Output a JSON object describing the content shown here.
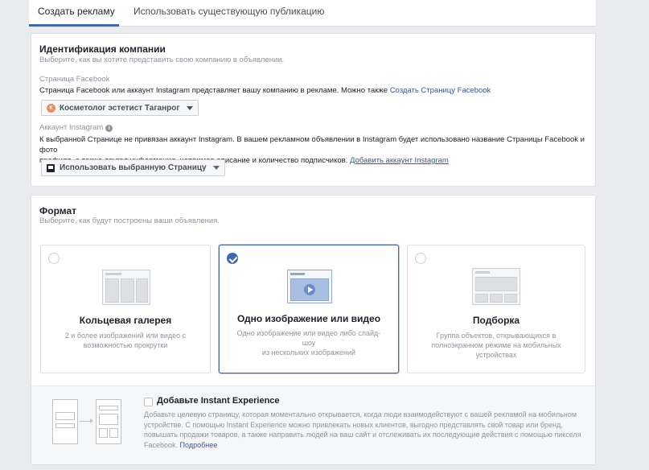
{
  "tabs": [
    {
      "label": "Создать рекламу",
      "active": true
    },
    {
      "label": "Использовать существующую публикацию",
      "active": false
    }
  ],
  "identity": {
    "title": "Идентификация компании",
    "subtitle": "Выберите, как вы хотите представить свою компанию в объявлении.",
    "fb_label": "Страница Facebook",
    "fb_text": "Страница Facebook или аккаунт Instagram представляет вашу компанию в рекламе. Можно также",
    "fb_link": "Создать Страницу Facebook",
    "page_dropdown": "Косметолог эстетист Таганрог",
    "page_avatar_letter": "К",
    "ig_label": "Аккаунт Instagram",
    "ig_text_1": "К выбранной Странице не привязан аккаунт Instagram. В вашем рекламном объявлении в Instagram будет использовано название Страницы Facebook и фото",
    "ig_text_2": "профиля, а также другая информация, например описание и количество подписчиков.",
    "ig_link": "Добавить аккаунт Instagram",
    "ig_dropdown": "Использовать выбранную Страницу"
  },
  "format": {
    "title": "Формат",
    "subtitle": "Выберите, как будут построены ваши объявления.",
    "options": [
      {
        "title": "Кольцевая галерея",
        "desc_1": "2 и более изображений или видео с",
        "desc_2": "возможностью прокрутки",
        "desc_3": "",
        "selected": false
      },
      {
        "title": "Одно изображение или видео",
        "desc_1": "Одно изображение или видео либо слайд-шоу",
        "desc_2": "из нескольких изображений",
        "desc_3": "",
        "selected": true
      },
      {
        "title": "Подборка",
        "desc_1": "Группа объектов, открывающихся в",
        "desc_2": "полноэкранном режиме на мобильных",
        "desc_3": "устройствах",
        "selected": false
      }
    ]
  },
  "instant_experience": {
    "title": "Добавьте Instant Experience",
    "line_1": "Добавьте целевую страницу, которая моментально открывается, когда люди взаимодействуют с вашей рекламой на мобильном",
    "line_2": "устройстве. С помощью Instant Experience можно привлекать новых клиентов, выгодно представлять свой товар или бренд,",
    "line_3": "повышать продажи товаров, а также направить людей на ваш сайт и отслеживать их последующие действия с помощью пикселя",
    "line_4": "Facebook.",
    "more_link": "Подробнее",
    "checked": false
  },
  "colors": {
    "accent": "#4267b2",
    "link": "#365899",
    "muted": "#90949c"
  }
}
